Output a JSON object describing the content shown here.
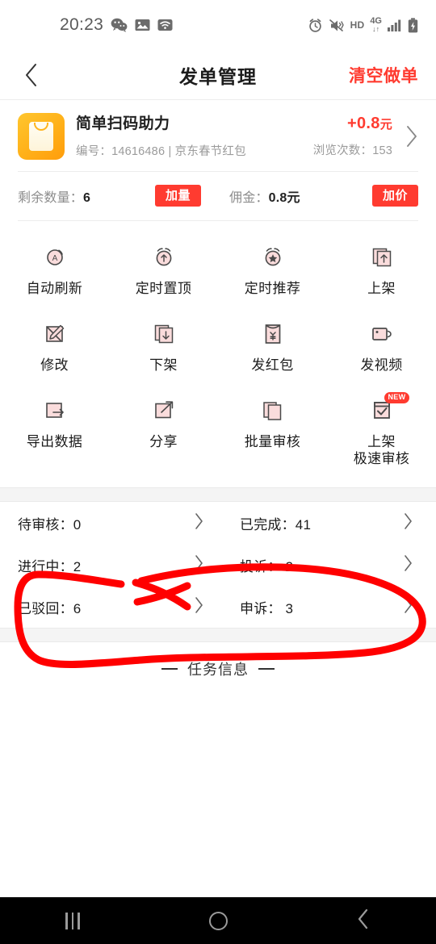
{
  "statusbar": {
    "time": "20:23",
    "hd_label": "HD",
    "network_label": "4G",
    "icons": [
      "wechat-icon",
      "gallery-icon",
      "wifi-icon",
      "alarm-icon",
      "vibrate-icon",
      "hd-icon",
      "network-4g-icon",
      "signal-icon",
      "battery-charging-icon"
    ]
  },
  "navbar": {
    "back": "‹",
    "title": "发单管理",
    "action": "清空做单"
  },
  "task_card": {
    "title": "简单扫码助力",
    "subtitle": "编号：14616486 | 京东春节红包",
    "amount": "+0.8",
    "amount_unit": "元",
    "views": "浏览次数：153",
    "remaining_label": "剩余数量：",
    "remaining_value": "6",
    "add_quantity_badge": "加量",
    "commission_label": "佣金：",
    "commission_value": "0.8元",
    "add_price_badge": "加价"
  },
  "actions": [
    {
      "label": "自动刷新",
      "icon": "auto-refresh-icon"
    },
    {
      "label": "定时置顶",
      "icon": "scheduled-top-icon"
    },
    {
      "label": "定时推荐",
      "icon": "scheduled-recommend-icon"
    },
    {
      "label": "上架",
      "icon": "list-up-icon"
    },
    {
      "label": "修改",
      "icon": "edit-icon"
    },
    {
      "label": "下架",
      "icon": "list-down-icon"
    },
    {
      "label": "发红包",
      "icon": "red-envelope-icon"
    },
    {
      "label": "发视频",
      "icon": "video-icon"
    },
    {
      "label": "导出数据",
      "icon": "export-icon"
    },
    {
      "label": "分享",
      "icon": "share-icon"
    },
    {
      "label": "批量审核",
      "icon": "batch-review-icon"
    },
    {
      "label": "上架\n极速审核",
      "label_line1": "上架",
      "label_line2": "极速审核",
      "icon": "fast-review-icon",
      "badge": "NEW"
    }
  ],
  "stats": [
    {
      "label": "待审核：0",
      "name": "pending-review"
    },
    {
      "label": "已完成：41",
      "name": "completed"
    },
    {
      "label": "进行中：2",
      "name": "in-progress"
    },
    {
      "label": "投诉：  2",
      "name": "complaints"
    },
    {
      "label": "已驳回：6",
      "name": "rejected"
    },
    {
      "label": "申诉：  3",
      "name": "appeals"
    }
  ],
  "section": {
    "task_info": "任务信息"
  },
  "annotation": {
    "color": "#ff0000",
    "type": "hand-drawn-circle-with-strike",
    "target": "bottom-stats-rows"
  },
  "android_nav": {
    "recents": "recents-button",
    "home": "home-button",
    "back": "back-button"
  },
  "colors": {
    "accent_red": "#ff3b30",
    "icon_pink": "#fadcdc",
    "icon_outline": "#4a4a4a",
    "brand_orange": "#ffb019",
    "annotation_red": "#ff0000"
  }
}
